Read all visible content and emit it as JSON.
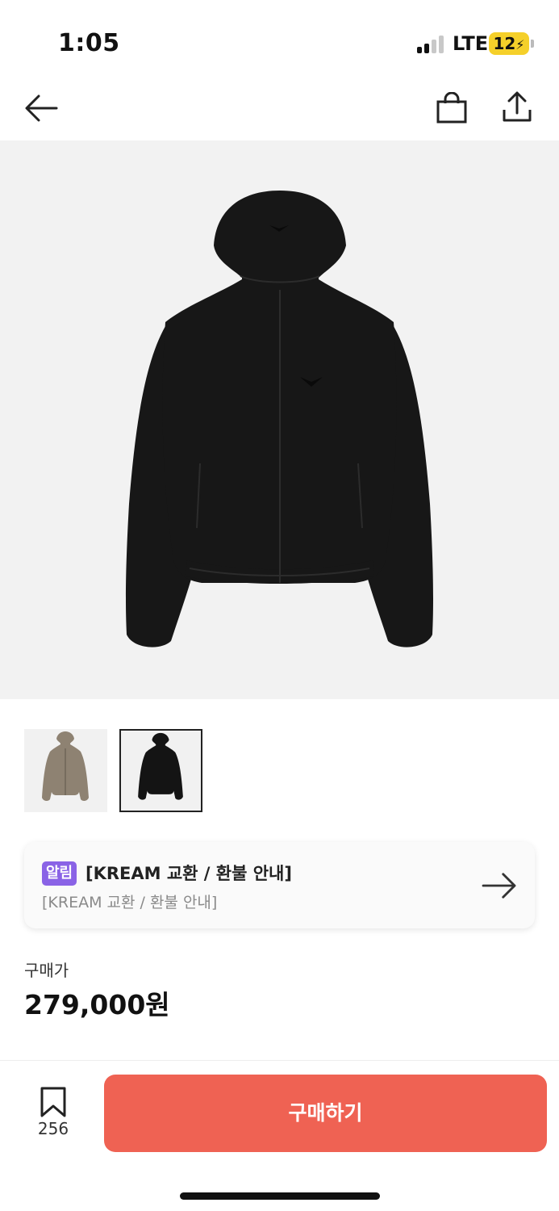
{
  "status_bar": {
    "time": "1:05",
    "network": "LTE",
    "battery": "12"
  },
  "nav": {
    "back_icon": "arrow-left-icon",
    "bag_icon": "shopping-bag-icon",
    "share_icon": "share-icon"
  },
  "product": {
    "thumbnails": [
      {
        "color": "#8e8272",
        "selected": false
      },
      {
        "color": "#141414",
        "selected": true
      }
    ]
  },
  "notice": {
    "badge": "알림",
    "title": "[KREAM 교환 / 환불 안내]",
    "subtitle": "[KREAM 교환 / 환불 안내]"
  },
  "price": {
    "label": "구매가",
    "value": "279,000원"
  },
  "bottom": {
    "bookmark_count": "256",
    "buy_label": "구매하기"
  },
  "colors": {
    "accent": "#ef6253",
    "badge": "#8a63e6",
    "battery": "#f5d02a"
  }
}
